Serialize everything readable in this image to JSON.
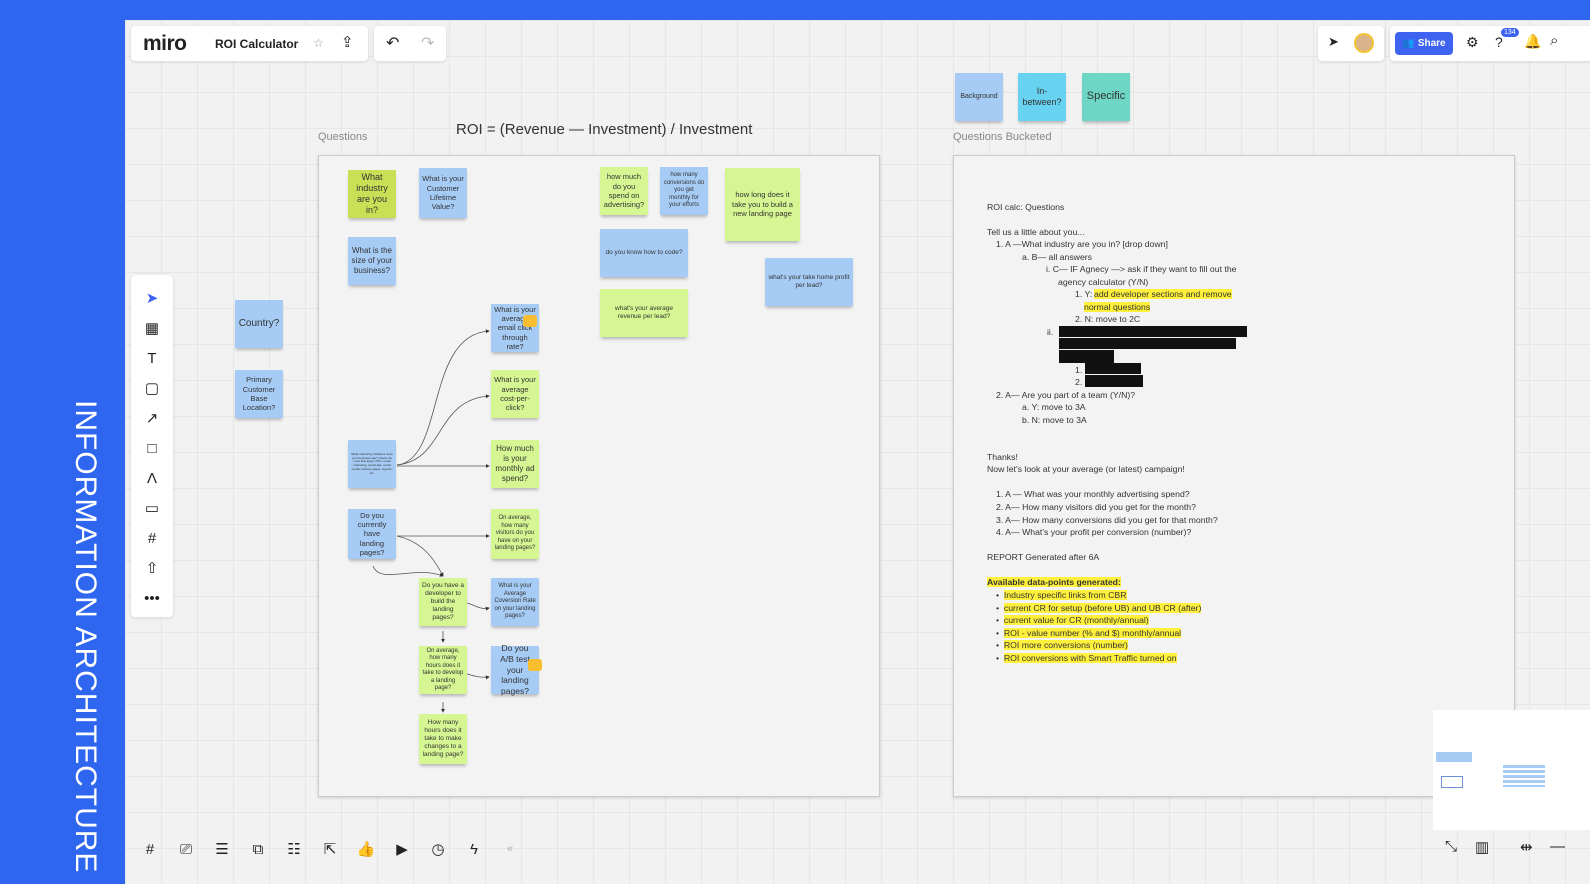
{
  "side_title": "INFORMATION ARCHITECTURE",
  "app": {
    "logo": "miro",
    "board_title": "ROI Calculator",
    "share_label": "Share",
    "notification_count": "134"
  },
  "board": {
    "formula": "ROI = (Revenue — Investment) / Investment",
    "frame_questions_label": "Questions",
    "frame_bucketed_label": "Questions Bucketed",
    "legend": [
      "Background",
      "In-between?",
      "Specific"
    ],
    "outside_stickies": [
      "Country?",
      "Primary Customer Base Location?"
    ],
    "stickies": [
      "What industry are you in?",
      "What is your Customer Lifetime Value?",
      "What is the size of your business?",
      "What is your average email click through rate?",
      "What is your average cost-per-click?",
      "How much is your monthly ad spend?",
      "What marketing initiatives does your business use? Check the ones that apply: PPC, email marketing, social ads, social media, landing pages, organic, etc.",
      "Do you currently have landing pages?",
      "On average, how many visitors do you have on your landing pages?",
      "Do you have a developer to build the landing pages?",
      "What is your Average Coversion Rate on your landing pages?",
      "On average, how many hours does it take to develop a landing page?",
      "Do you A/B test your landing pages?",
      "How many hours does it take to make changes to a landing page?",
      "how much do you spend on advertising?",
      "how many conversions do you get monthly for your efforts",
      "how long does it take you to build a new landing page",
      "do you know how to code?",
      "what's your average revenue per lead?",
      "what's your take home profit per lead?"
    ],
    "doc": {
      "lines": [
        "ROI calc: Questions",
        "Tell us a little about you...",
        "1. A —What industry are you in? [drop down]",
        "a. B— all answers",
        "i. C— IF Agnecy —> ask if they want to fill out the",
        "agency calculator (Y/N)",
        "1. Y:",
        "add developer sections and remove",
        "normal questions",
        "2. N: move to 2C",
        "ii.",
        "1.",
        "2.",
        "2. A— Are you part of a team (Y/N)?",
        "a. Y: move to 3A",
        "b. N: move to 3A",
        "Thanks!",
        "Now let's look at your average (or latest) campaign!",
        "1. A — What was your monthly advertising spend?",
        "2. A— How many visitors did you get for the month?",
        "3. A— How many conversions did you get for that month?",
        "4. A— What's your profit per conversion (number)?",
        "REPORT Generated after 6A",
        "Available data-points  generated:"
      ],
      "bullets": [
        "Industry specific links from CBR",
        "current CR for setup (before UB) and UB CR (after)",
        "current value for CR (monthly/annual)",
        "ROI - value number (% and $) monthly/annual",
        "ROI more conversions (number)",
        "ROI conversions with Smart Traffic turned on"
      ]
    }
  },
  "colors": {
    "brand_blue": "#2f66f0",
    "sticky_green": "#d5f692",
    "sticky_lime": "#c9df56",
    "sticky_blue": "#a6ccf5",
    "sticky_cyan": "#67d3f0",
    "sticky_teal": "#6dd6c4",
    "highlight": "#fff13b"
  }
}
